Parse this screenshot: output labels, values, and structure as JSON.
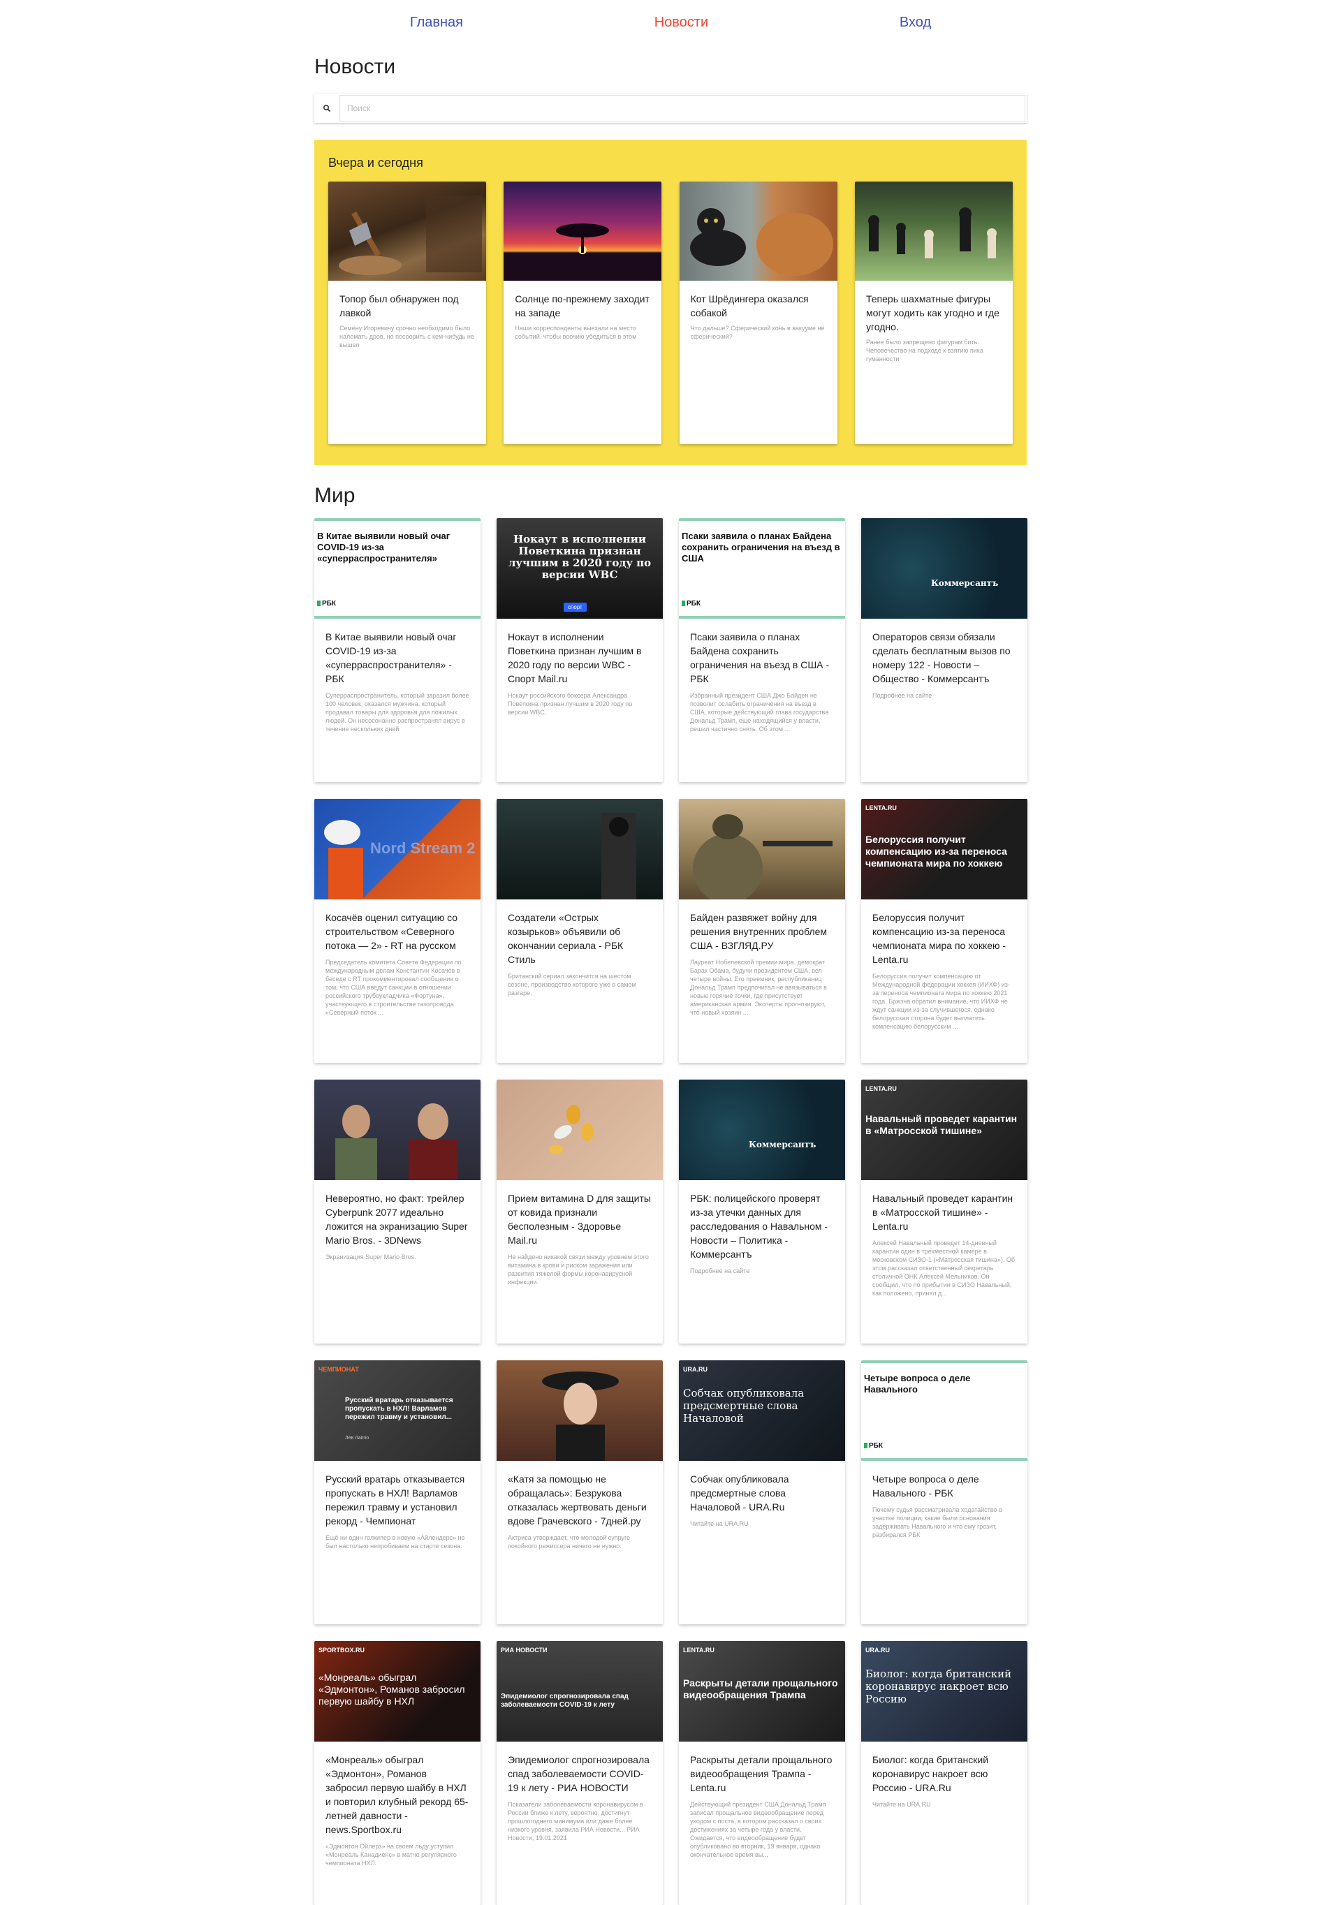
{
  "nav": {
    "home": "Главная",
    "news": "Новости",
    "login": "Вход"
  },
  "page_title": "Новости",
  "search": {
    "placeholder": "Поиск"
  },
  "featured": {
    "heading": "Вчера и сегодня",
    "cards": [
      {
        "title": "Топор был обнаружен под лавкой",
        "desc": "Семёну Игоревичу срочно необходимо было наломать дров, но посоорить с кем-нибудь не вышел"
      },
      {
        "title": "Солнце по-прежнему заходит на западе",
        "desc": "Наши корреспонденты выехали на место событий, чтобы воочию убедиться в этом"
      },
      {
        "title": "Кот Шрёдингера оказался собакой",
        "desc": "Что дальше? Сферический конь в вакууме не сферический?"
      },
      {
        "title": "Теперь шахматные фигуры могут ходить как угодно и где угодно.",
        "desc": "Ранее было запрещено фигурам бить. Человечество на подходе к взятию пика гуманности"
      }
    ]
  },
  "world": {
    "heading": "Мир",
    "cards": [
      {
        "img_text": "В Китае выявили новый очаг COVID-19 из-за «суперраспространителя»",
        "img_source": "РБК",
        "title": "В Китае выявили новый очаг COVID-19 из-за «суперраспространителя» - РБК",
        "desc": "Суперраспространитель, который заразил более 100 человек, оказался мужчина, который продавал товары для здоровья для пожилых людей. Он несосонанно распространял вирус в течение нескольких дней"
      },
      {
        "img_text": "Нокаут в исполнении Поветкина признан лучшим в 2020 году по версии WBC",
        "img_source": "спорт",
        "title": "Нокаут в исполнении Поветкина признан лучшим в 2020 году по версии WBC - Спорт Mail.ru",
        "desc": "Нокаут российского боксера Александра Поветкина признан лучшим в 2020 году по версии WBC."
      },
      {
        "img_text": "Псаки заявила о планах Байдена сохранить ограничения на въезд в США",
        "img_source": "РБК",
        "title": "Псаки заявила о планах Байдена сохранить ограничения на въезд в США - РБК",
        "desc": "Избранный президент США Джо Байден не позволит ослабить ограничения на въезд в США, которые действующий глава государства Дональд Трамп, еще находящийся у власти, решил частично снять. Об этом ..."
      },
      {
        "img_text": "Коммерсантъ",
        "title": "Операторов связи обязали сделать бесплатным вызов по номеру 122 - Новости – Общество - Коммерсантъ",
        "desc": "Подробнее на сайте"
      },
      {
        "img_text": "Nord Stream 2",
        "title": "Косачёв оценил ситуацию со строительством «Северного потока — 2» - RT на русском",
        "desc": "Председатель комитета Совета Федерации по международным делам Константин Косачёв в беседе с RT прокомментировал сообщения о том, что США введут санкции в отношении российского трубоукладчика «Фортуна», участвующего в строительстве газопровода «Северный поток ..."
      },
      {
        "title": "Создатели «Острых козырьков» объявили об окончании сериала - РБК Стиль",
        "desc": "Британский сериал закончится на шестом сезоне, производство которого уже в самом разгаре."
      },
      {
        "title": "Байден развяжет войну для решения внутренних проблем США - ВЗГЛЯД.РУ",
        "desc": "Лауреат Нобелевской премии мира, демократ Барак Обама, будучи президентом США, вел четыре войны. Его преемник, республиканец Дональд Трамп предпочитал не ввязываться в новые горячие точки, где присутствует американская армия. Эксперты прогнозируют, что новый хозяин ..."
      },
      {
        "img_text": "Белоруссия получит компенсацию из-за переноса чемпионата мира по хоккею",
        "img_source": "LENTA.RU",
        "title": "Белоруссия получит компенсацию из-за переноса чемпионата мира по хоккею - Lenta.ru",
        "desc": "Белоруссия получит компенсацию от Международной федерации хоккея (ИИХФ) из-за переноса чемпионата мира по хоккею 2021 года. Бржзна обратил внимание, что ИИХФ не ждут санкции из-за случившегося, однако белорусская сторона будет выплатить компенсацию белорусским ..."
      },
      {
        "title": "Невероятно, но факт: трейлер Cyberpunk 2077 идеально ложится на экранизацию Super Mario Bros. - 3DNews",
        "desc": "Экранизация Super Mario Bros."
      },
      {
        "title": "Прием витамина D для защиты от ковида признали бесполезным - Здоровье Mail.ru",
        "desc": "Не найдено никакой связи между уровнем этого витамина в крови и риском заражения или развития тяжелой формы коронавирусной инфекции."
      },
      {
        "img_text": "Коммерсантъ",
        "title": "РБК: полицейского проверят из-за утечки данных для расследования о Навальном - Новости – Политика - Коммерсантъ",
        "desc": "Подробнее на сайте"
      },
      {
        "img_text": "Навальный проведет карантин в «Матросской тишине»",
        "img_source": "LENTA.RU",
        "title": "Навальный проведет карантин в «Матросской тишине» - Lenta.ru",
        "desc": "Алексей Навальный проведет 14-дневный карантин один в трехместной камере в московском СИЗО-1 («Матросская тишина»). Об этом рассказал ответственный секретарь столичной ОНК Алексей Мельников. Он сообщил, что по прибытии в СИЗО Навальный, как положено, принял д..."
      },
      {
        "img_text": "Русский вратарь отказывается пропускать в НХЛ! Варламов пережил травму и установил...",
        "img_source": "ЧЕМПИОНАТ",
        "img_author": "Лев Лаппо",
        "title": "Русский вратарь отказывается пропускать в НХЛ! Варламов пережил травму и установил рекорд - Чемпионат",
        "desc": "Ещё ни один голкипер в новую «Айлендерс» не был настолько непробиваем на старте сезона."
      },
      {
        "title": "«Катя за помощью не обращалась»: Безрукова отказалась жертвовать деньги вдове Грачевского - 7дней.ру",
        "desc": "Актриса утверждает, что молодой супруге покойного режиссера ничего не нужно."
      },
      {
        "img_text": "Собчак опубликовала предсмертные слова Началовой",
        "img_source": "URA.RU",
        "title": "Собчак опубликовала предсмертные слова Началовой - URA.Ru",
        "desc": "Читайте на URA.RU"
      },
      {
        "img_text": "Четыре вопроса о деле Навального",
        "img_source": "РБК",
        "title": "Четыре вопроса о деле Навального - РБК",
        "desc": "Почему судья рассматривала ходатайство в участке полиции, какие были основания задерживать Навального и что ему грозит, разбирался РБК"
      },
      {
        "img_text": "«Монреаль» обыграл «Эдмонтон», Романов забросил первую шайбу в НХЛ",
        "img_source": "SPORTBOX.RU",
        "title": "«Монреаль» обыграл «Эдмонтон», Романов забросил первую шайбу в НХЛ и повторил клубный рекорд 65-летней давности - news.Sportbox.ru",
        "desc": "«Эдмонтон Ойлерз» на своем льду уступил «Монреаль Канадиенс» в матче регулярного чемпионата НХЛ."
      },
      {
        "img_text": "Эпидемиолог спрогнозировала спад заболеваемости COVID-19 к лету",
        "img_source": "РИА НОВОСТИ",
        "title": "Эпидемиолог спрогнозировала спад заболеваемости COVID-19 к лету - РИА НОВОСТИ",
        "desc": "Показатели заболеваемости коронавирусом в России ближе к лету, вероятно, достигнут прошлогоднего минимума или даже более низкого уровня, заявила РИА Новости... РИА Новости, 19.01.2021"
      },
      {
        "img_text": "Раскрыты детали прощального видеообращения Трампа",
        "img_source": "LENTA.RU",
        "title": "Раскрыты детали прощального видеообращения Трампа - Lenta.ru",
        "desc": "Действующий президент США Дональд Трамп записал прощальное видеообращение перед уходом с поста, в котором рассказал о своих достижениях за четыре года у власти. Ожидается, что видеообращение будет опубликовано во вторник, 19 января, однако окончательное время вы..."
      },
      {
        "img_text": "Биолог: когда британский коронавирус накроет всю Россию",
        "img_source": "URA.RU",
        "title": "Биолог: когда британский коронавирус накроет всю Россию - URA.Ru",
        "desc": "Читайте на URA.RU"
      }
    ]
  },
  "colors": {
    "accent_red": "#f44336",
    "nav_blue": "#3f51b5",
    "featured_bg": "#f8df4a",
    "rbk_green": "#8fd1b6"
  }
}
